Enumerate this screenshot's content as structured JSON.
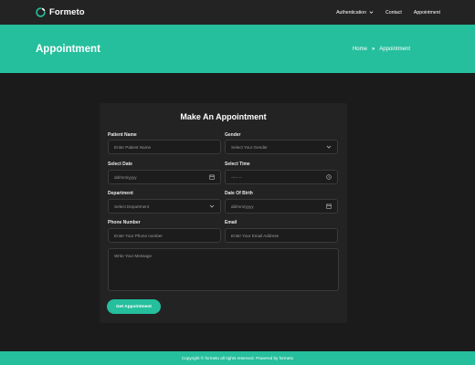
{
  "brand": {
    "name": "Formeto",
    "logo_icon": "spinner-logo-icon"
  },
  "nav": {
    "items": [
      {
        "label": "Authentication",
        "has_dropdown": true
      },
      {
        "label": "Contact"
      },
      {
        "label": "Appointment"
      }
    ]
  },
  "hero": {
    "title": "Appointment",
    "breadcrumb": {
      "home": "Home",
      "separator": "»",
      "current": "Appointment"
    }
  },
  "form": {
    "title": "Make An Appointment",
    "patient_name": {
      "label": "Patient Name",
      "placeholder": "Enter Patient Name"
    },
    "gender": {
      "label": "Gender",
      "value": "Select Your Gender"
    },
    "select_date": {
      "label": "Select Date",
      "value": "dd/mm/yyyy"
    },
    "select_time": {
      "label": "Select Time",
      "value": "--:-- --"
    },
    "department": {
      "label": "Department",
      "value": "Select Department"
    },
    "date_of_birth": {
      "label": "Date Of Birth",
      "value": "dd/mm/yyyy"
    },
    "phone": {
      "label": "Phone Number",
      "placeholder": "Enter Your Phone number"
    },
    "email": {
      "label": "Email",
      "placeholder": "Enter Your Email Address"
    },
    "message": {
      "placeholder": "Write Your Message"
    },
    "submit_label": "Get Appointment"
  },
  "footer": {
    "text": "Copyright © formeto all rights reserved. Powered by formeto"
  },
  "colors": {
    "accent": "#25bf9d",
    "background": "#1b1b1b",
    "card": "#232323",
    "navbar": "#232323"
  }
}
